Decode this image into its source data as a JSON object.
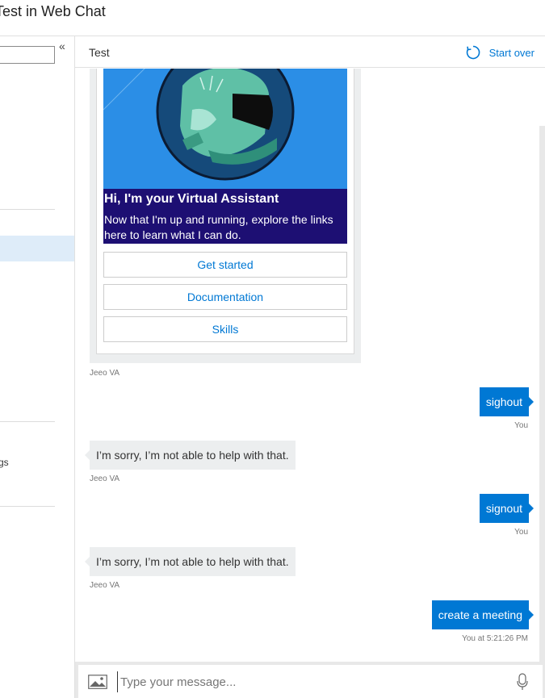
{
  "window": {
    "title": "Test in Web Chat"
  },
  "left_panel": {
    "collapse_glyph": "«",
    "fragment_text": "gs"
  },
  "chat": {
    "header_title": "Test",
    "start_over_label": "Start over",
    "start_over_icon": "refresh-icon",
    "card": {
      "heading": "Hi, I'm your Virtual Assistant",
      "body": "Now that I'm up and running, explore the links here to learn what I can do.",
      "buttons": [
        "Get started",
        "Documentation",
        "Skills"
      ],
      "sender": "Jeeo VA"
    },
    "messages": [
      {
        "from": "user",
        "text": "sighout",
        "meta": "You"
      },
      {
        "from": "bot",
        "text": "I’m sorry, I’m not able to help with that.",
        "meta": "Jeeo VA"
      },
      {
        "from": "user",
        "text": "signout",
        "meta": "You"
      },
      {
        "from": "bot",
        "text": "I’m sorry, I’m not able to help with that.",
        "meta": "Jeeo VA"
      },
      {
        "from": "user",
        "text": "create a meeting",
        "meta": "You at 5:21:26 PM"
      }
    ],
    "composer": {
      "placeholder": "Type your message...",
      "upload_icon": "image-icon",
      "mic_icon": "microphone-icon"
    }
  },
  "colors": {
    "accent": "#0078d4",
    "card_hero": "#2b8ee6",
    "card_text_bg": "#1d0f73",
    "bot_bubble": "#eceeef",
    "selection": "#deecf9"
  }
}
